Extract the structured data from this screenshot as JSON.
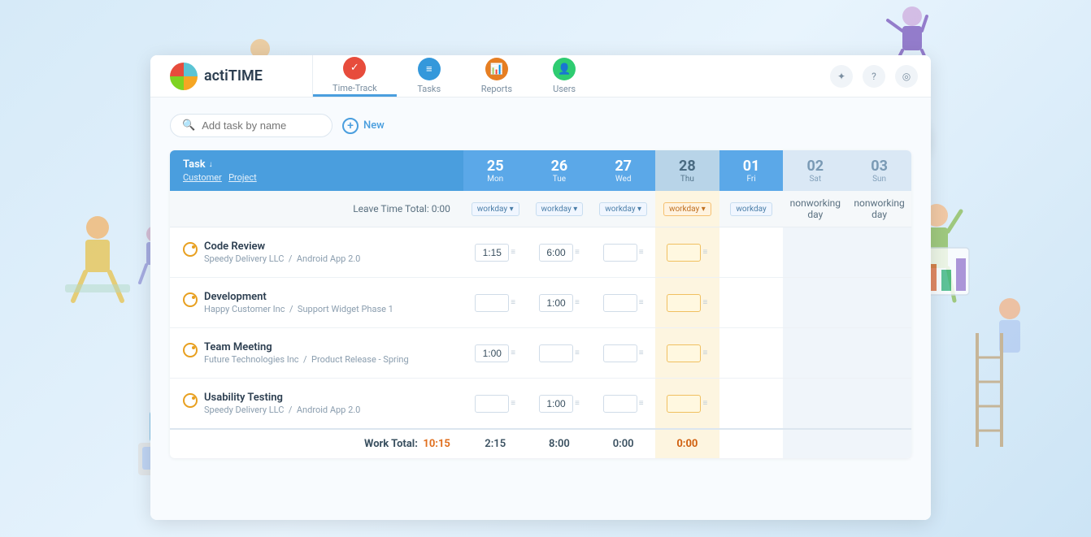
{
  "app": {
    "name": "actiTIME"
  },
  "nav": {
    "items": [
      {
        "id": "timetrack",
        "label": "Time-Track",
        "icon": "check",
        "color": "icon-red",
        "active": true
      },
      {
        "id": "tasks",
        "label": "Tasks",
        "icon": "list",
        "color": "icon-blue",
        "active": false
      },
      {
        "id": "reports",
        "label": "Reports",
        "icon": "chart",
        "color": "icon-orange",
        "active": false
      },
      {
        "id": "users",
        "label": "Users",
        "icon": "person",
        "color": "icon-green",
        "active": false
      }
    ]
  },
  "toolbar": {
    "search_placeholder": "Add task by name",
    "new_label": "New"
  },
  "table": {
    "header": {
      "task_col": "Task",
      "sort_indicator": "↓",
      "customer_label": "Customer",
      "project_label": "Project",
      "days": [
        {
          "num": "25",
          "name": "Mon",
          "type": "normal"
        },
        {
          "num": "26",
          "name": "Tue",
          "type": "normal"
        },
        {
          "num": "27",
          "name": "Wed",
          "type": "normal"
        },
        {
          "num": "28",
          "name": "Thu",
          "type": "today"
        },
        {
          "num": "01",
          "name": "Fri",
          "type": "normal"
        },
        {
          "num": "02",
          "name": "Sat",
          "type": "weekend"
        },
        {
          "num": "03",
          "name": "Sun",
          "type": "weekend"
        }
      ]
    },
    "leave_row": {
      "label": "Leave Time Total: 0:00",
      "cells": [
        "workday",
        "workday",
        "workday",
        "workday",
        "workday",
        "nonworking day",
        "nonworking day"
      ]
    },
    "tasks": [
      {
        "id": 1,
        "name": "Code Review",
        "customer": "Speedy Delivery LLC",
        "project": "Android App 2.0",
        "times": [
          "1:15",
          "6:00",
          "",
          "",
          "",
          "",
          ""
        ]
      },
      {
        "id": 2,
        "name": "Development",
        "customer": "Happy Customer Inc",
        "project": "Support Widget Phase 1",
        "times": [
          "",
          "1:00",
          "",
          "",
          "",
          "",
          ""
        ]
      },
      {
        "id": 3,
        "name": "Team Meeting",
        "customer": "Future Technologies Inc",
        "project": "Product Release - Spring",
        "times": [
          "1:00",
          "",
          "",
          "",
          "",
          "",
          ""
        ]
      },
      {
        "id": 4,
        "name": "Usability Testing",
        "customer": "Speedy Delivery LLC",
        "project": "Android App 2.0",
        "times": [
          "",
          "1:00",
          "",
          "",
          "",
          "",
          ""
        ]
      }
    ],
    "totals": {
      "label": "Work Total:",
      "total_time": "10:15",
      "day_totals": [
        "2:15",
        "8:00",
        "0:00",
        "0:00",
        "",
        "",
        ""
      ]
    }
  }
}
